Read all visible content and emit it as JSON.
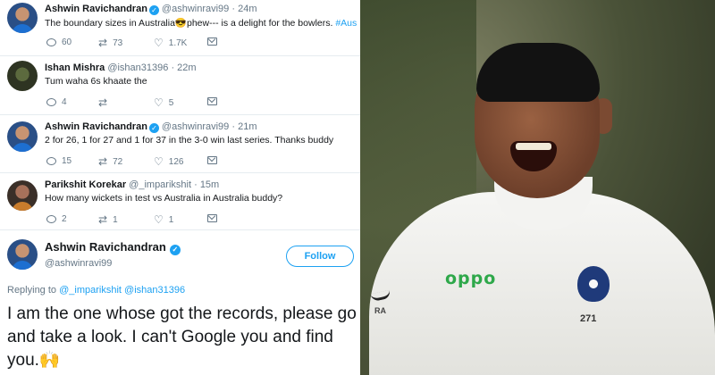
{
  "tweets": [
    {
      "name": "Ashwin Ravichandran",
      "verified": true,
      "handle": "@ashwinravi99",
      "time": "· 24m",
      "text_before": "The boundary sizes in Australia",
      "emoji": "😎",
      "text_after": "phew--- is a delight for the bowlers.",
      "hashtag": "#Aus",
      "stats": {
        "reply": "60",
        "retweet": "73",
        "like": "1.7K"
      }
    },
    {
      "name": "Ishan Mishra",
      "handle": "@ishan31396",
      "time": "· 22m",
      "text": "Tum waha 6s khaate the",
      "stats": {
        "reply": "4",
        "like": "5"
      }
    },
    {
      "name": "Ashwin Ravichandran",
      "verified": true,
      "handle": "@ashwinravi99",
      "time": "· 21m",
      "text": "2 for 26, 1 for 27 and 1 for 37 in the 3-0 win last series. Thanks buddy",
      "stats": {
        "reply": "15",
        "retweet": "72",
        "like": "126"
      }
    },
    {
      "name": "Parikshit Korekar",
      "handle": "@_imparikshit",
      "time": "· 15m",
      "text": "How many wickets in test vs Australia in Australia buddy?",
      "stats": {
        "reply": "2",
        "retweet": "1",
        "like": "1"
      }
    }
  ],
  "main_tweet": {
    "name": "Ashwin Ravichandran",
    "handle": "@ashwinravi99",
    "follow_label": "Follow",
    "replying_prefix": "Replying to",
    "replying_to_1": "@_imparikshit",
    "replying_to_2": "@ishan31396",
    "text": "I am the one whose got the records, please go and take a look. I can't Google you and find you.",
    "emoji": "🙌"
  },
  "photo": {
    "sponsor_logo": "oppo",
    "shirt_number": "271",
    "shirt_initials": "RA"
  },
  "icons": {
    "reply": "reply-icon",
    "retweet": "retweet-icon",
    "like": "heart-icon",
    "dm": "mail-icon",
    "verified": "verified-badge-icon"
  },
  "colors": {
    "accent": "#1da1f2",
    "secondary_text": "#657786",
    "separator": "#e6ecf0"
  }
}
